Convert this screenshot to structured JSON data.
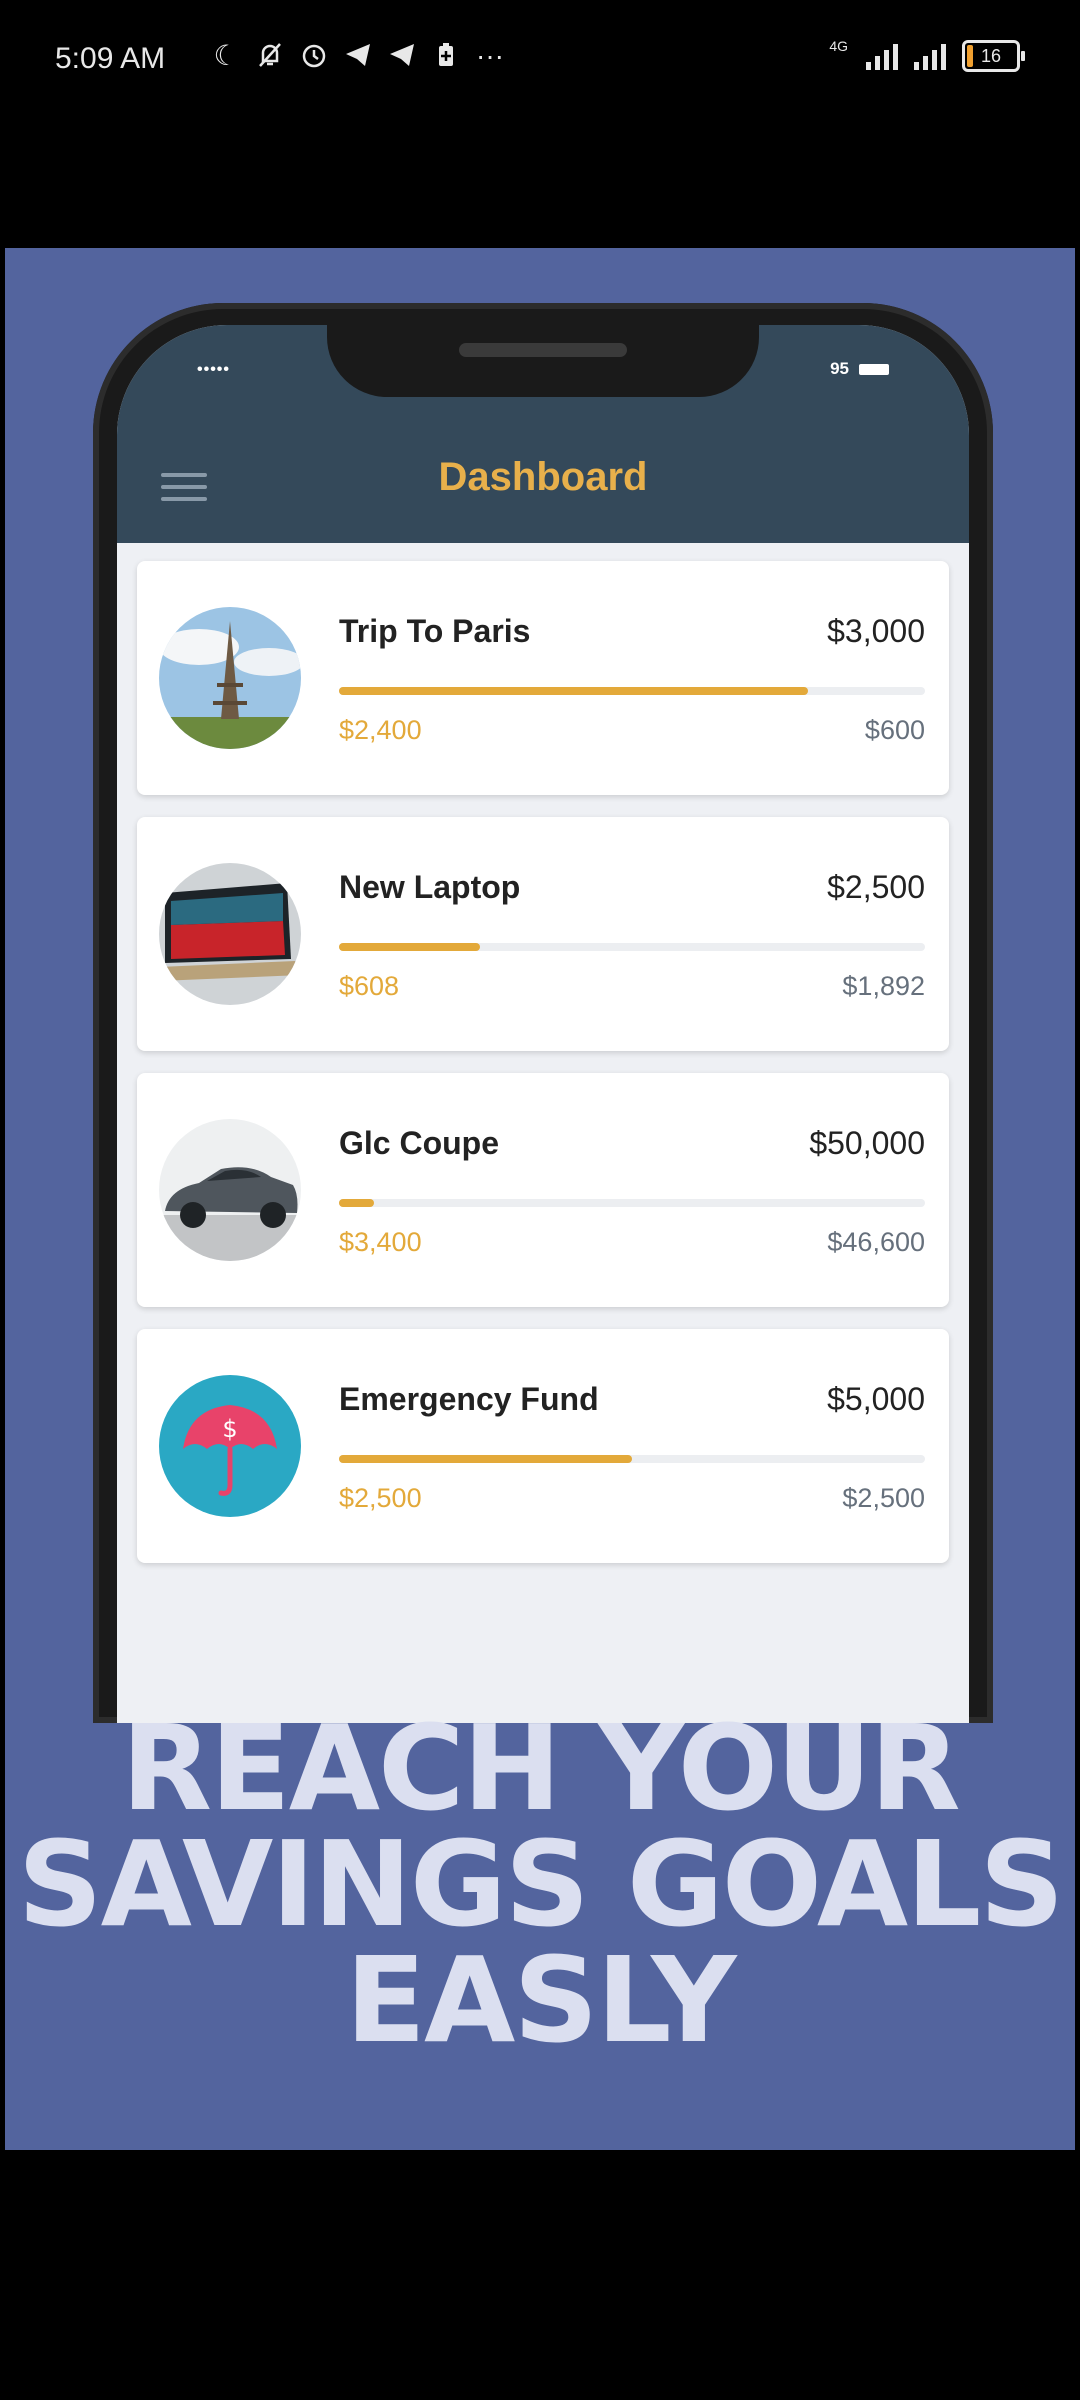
{
  "status_bar": {
    "time": "5:09 AM",
    "icons": [
      "moon-icon",
      "bell-off-icon",
      "alarm-icon",
      "telegram-icon",
      "telegram-icon",
      "battery-saver-icon",
      "more-icon"
    ],
    "network_label": "4G",
    "battery": "16"
  },
  "phone": {
    "status_dots": "•••••",
    "battery_level": "95",
    "header": {
      "title": "Dashboard"
    }
  },
  "goals": [
    {
      "name": "Trip To Paris",
      "total": "$3,000",
      "saved": "$2,400",
      "remaining": "$600",
      "progress": 0.8,
      "image": "eiffel-tower"
    },
    {
      "name": "New Laptop",
      "total": "$2,500",
      "saved": "$608",
      "remaining": "$1,892",
      "progress": 0.24,
      "image": "laptop"
    },
    {
      "name": "Glc Coupe",
      "total": "$50,000",
      "saved": "$3,400",
      "remaining": "$46,600",
      "progress": 0.06,
      "image": "car"
    },
    {
      "name": "Emergency Fund",
      "total": "$5,000",
      "saved": "$2,500",
      "remaining": "$2,500",
      "progress": 0.5,
      "image": "umbrella-dollar"
    }
  ],
  "headline": {
    "line1": "REACH YOUR",
    "line2": "SAVINGS GOALS",
    "line3": "EASLY"
  },
  "colors": {
    "promo_bg": "#53649e",
    "header_bg": "#34495a",
    "accent": "#e3a93a"
  }
}
